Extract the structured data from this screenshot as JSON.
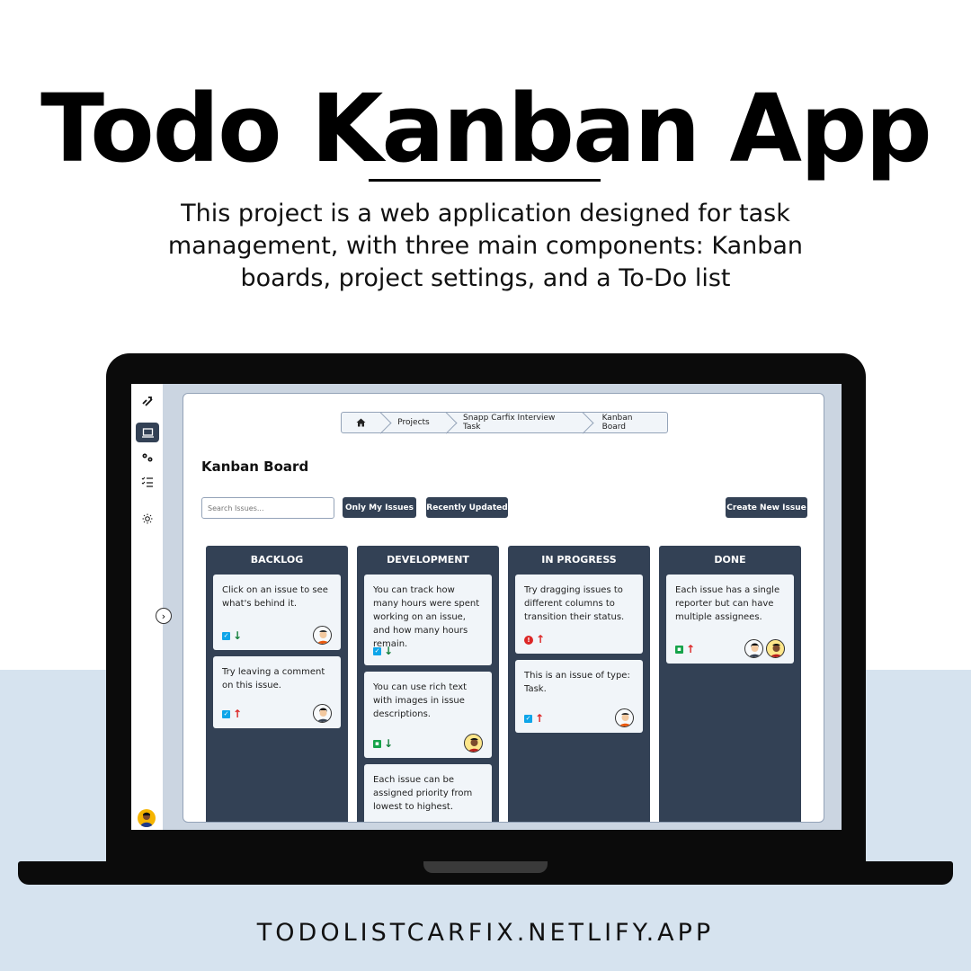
{
  "hero": {
    "title": "Todo Kanban App",
    "subtitle": "This project is a web application designed for task management, with three main components: Kanban boards, project settings, and a To-Do list"
  },
  "footer": {
    "url": "TODOLISTCARFIX.NETLIFY.APP"
  },
  "colors": {
    "sidebar_active": "#334155",
    "column_bg": "#334155",
    "card_bg": "#f1f5f9",
    "priority_low": "#15803d",
    "priority_high": "#dc2626",
    "type_task": "#0ea5e9",
    "type_story": "#16a34a",
    "type_bug": "#dc2626",
    "bottom_band": "#d6e3ef"
  },
  "sidebar": {
    "items": [
      {
        "icon": "logo-icon"
      },
      {
        "icon": "board-icon",
        "active": true
      },
      {
        "icon": "settings-icon"
      },
      {
        "icon": "todo-list-icon"
      },
      {
        "icon": "theme-sun-icon"
      }
    ],
    "toggle_icon": "chevron-right-icon",
    "user_icon": "user-avatar-icon"
  },
  "breadcrumb": {
    "home_icon": "home-icon",
    "items": [
      "Projects",
      "Snapp Carfix Interview Task",
      "Kanban Board"
    ]
  },
  "page": {
    "title": "Kanban Board",
    "search_placeholder": "Search Issues...",
    "filter_buttons": [
      "Only My Issues",
      "Recently Updated"
    ],
    "create_button": "Create New Issue"
  },
  "columns": [
    {
      "title": "BACKLOG",
      "cards": [
        {
          "text": "Click on an issue to see what's behind it.",
          "type": "task",
          "priority": "low",
          "assignees": [
            "avatar-1"
          ]
        },
        {
          "text": "Try leaving a comment on this issue.",
          "type": "task",
          "priority": "high",
          "assignees": [
            "avatar-2"
          ]
        }
      ]
    },
    {
      "title": "DEVELOPMENT",
      "cards": [
        {
          "text": "You can track how many hours were spent working on an issue, and how many hours remain.",
          "type": "task",
          "priority": "low",
          "assignees": []
        },
        {
          "text": "You can use rich text with images in issue descriptions.",
          "type": "story",
          "priority": "low",
          "assignees": [
            "avatar-3"
          ]
        },
        {
          "text": "Each issue can be assigned priority from lowest to highest.",
          "type": "task",
          "priority": "low",
          "assignees": []
        }
      ]
    },
    {
      "title": "IN PROGRESS",
      "cards": [
        {
          "text": "Try dragging issues to different columns to transition their status.",
          "type": "bug",
          "priority": "high",
          "assignees": []
        },
        {
          "text": "This is an issue of type: Task.",
          "type": "task",
          "priority": "high",
          "assignees": [
            "avatar-1"
          ]
        }
      ]
    },
    {
      "title": "DONE",
      "cards": [
        {
          "text": "Each issue has a single reporter but can have multiple assignees.",
          "type": "story",
          "priority": "high",
          "assignees": [
            "avatar-2",
            "avatar-3"
          ]
        }
      ]
    }
  ]
}
